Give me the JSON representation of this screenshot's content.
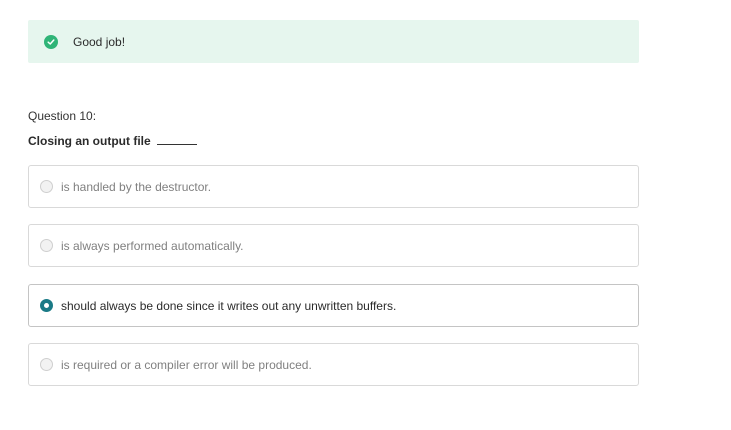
{
  "feedback": {
    "icon": "check-circle-icon",
    "text": "Good job!",
    "color": "#2fb477",
    "background": "#e6f6ee"
  },
  "question": {
    "number_label": "Question 10:",
    "prompt": "Closing an output file"
  },
  "options": [
    {
      "label": "is handled by the destructor.",
      "selected": false
    },
    {
      "label": "is always performed automatically.",
      "selected": false
    },
    {
      "label": "should always be done since it writes out any unwritten buffers.",
      "selected": true
    },
    {
      "label": "is required or a compiler error will be produced.",
      "selected": false
    }
  ],
  "accent_color": "#1a7a86"
}
